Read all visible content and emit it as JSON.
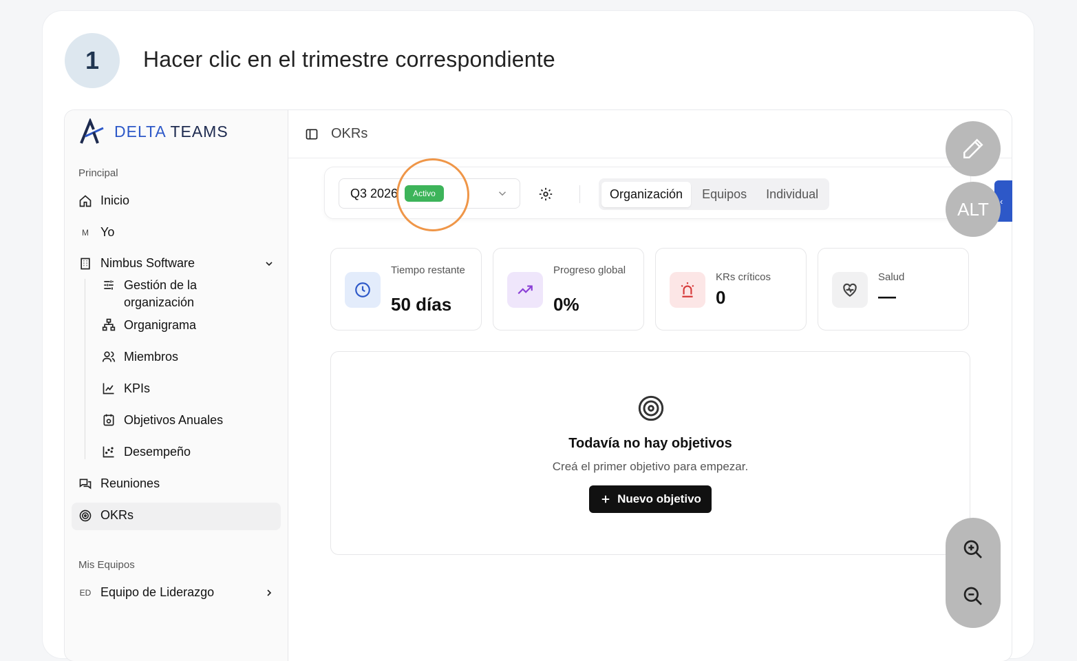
{
  "step": {
    "number": "1",
    "title": "Hacer clic en el trimestre correspondiente"
  },
  "brand": {
    "name_a": "DELTA",
    "name_b": "TEAMS"
  },
  "sidebar": {
    "section_principal": "Principal",
    "items": {
      "inicio": "Inicio",
      "yo_initial": "M",
      "yo": "Yo",
      "org": "Nimbus Software",
      "gestion": "Gestión de la organización",
      "organigrama": "Organigrama",
      "miembros": "Miembros",
      "kpis": "KPIs",
      "objetivos": "Objetivos Anuales",
      "desempeno": "Desempeño",
      "reuniones": "Reuniones",
      "okrs": "OKRs"
    },
    "section_equipos": "Mis Equipos",
    "team_initials": "ED",
    "team_name": "Equipo de Liderazgo"
  },
  "topbar": {
    "title": "OKRs"
  },
  "filter": {
    "quarter": "Q3 2026",
    "status_badge": "Activo",
    "tabs": [
      "Organización",
      "Equipos",
      "Individual"
    ]
  },
  "stats": [
    {
      "label": "Tiempo restante",
      "value": "50 días"
    },
    {
      "label": "Progreso global",
      "value": "0%"
    },
    {
      "label": "KRs críticos",
      "value": "0"
    },
    {
      "label": "Salud",
      "value": "—"
    }
  ],
  "empty": {
    "title": "Todavía no hay objetivos",
    "subtitle": "Creá el primer objetivo para empezar.",
    "button": "Nuevo objetivo"
  },
  "overlay": {
    "alt_label": "ALT",
    "collapse_glyph": "‹"
  },
  "colors": {
    "accent": "#2d58c8",
    "active_badge": "#3db45a",
    "highlight": "#ef9648"
  }
}
